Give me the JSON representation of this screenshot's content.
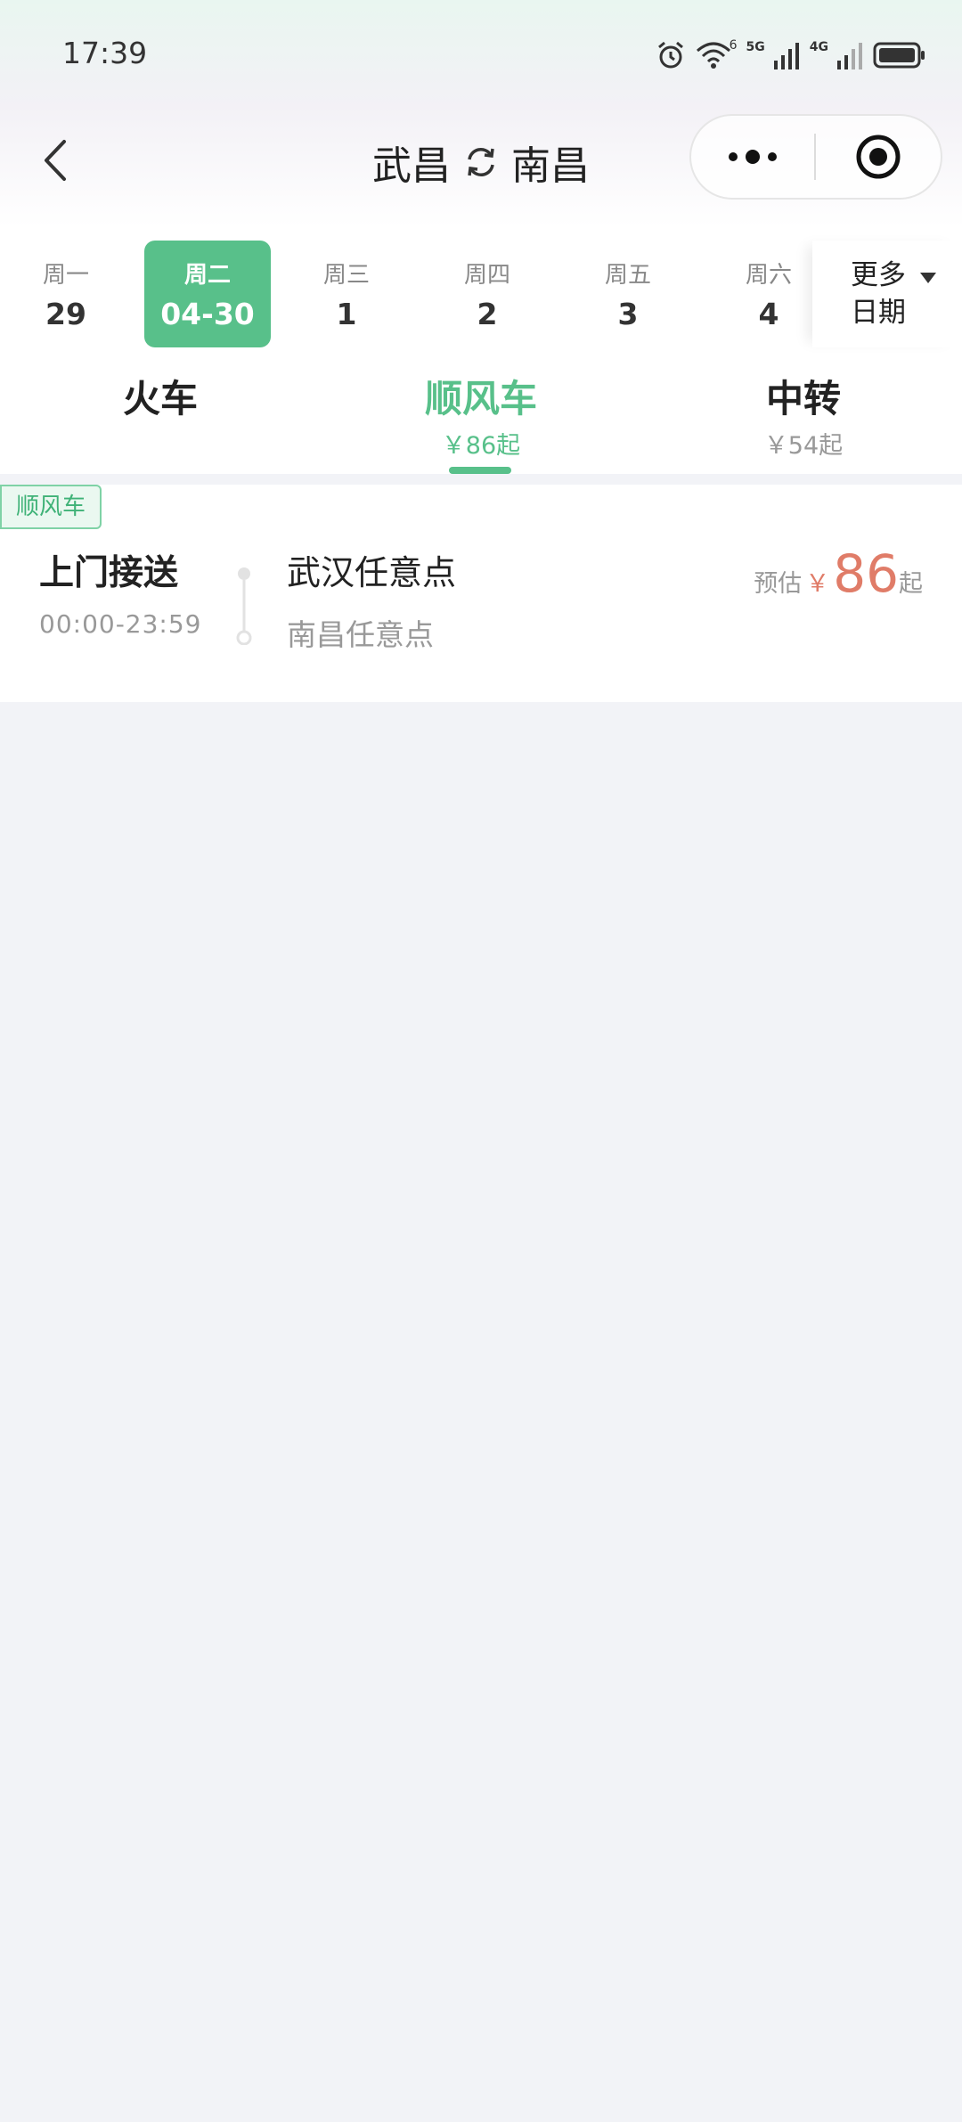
{
  "status": {
    "time": "17:39",
    "net1": "5G",
    "net2": "4G",
    "sim": "6"
  },
  "route": {
    "from": "武昌",
    "to": "南昌"
  },
  "dates": [
    {
      "weekday": "周一",
      "date": "29"
    },
    {
      "weekday": "周二",
      "date": "04-30",
      "active": true
    },
    {
      "weekday": "周三",
      "date": "1"
    },
    {
      "weekday": "周四",
      "date": "2"
    },
    {
      "weekday": "周五",
      "date": "3"
    },
    {
      "weekday": "周六",
      "date": "4"
    }
  ],
  "more_dates": {
    "line1": "更多",
    "line2": "日期"
  },
  "tabs": [
    {
      "name": "火车",
      "price": ""
    },
    {
      "name": "顺风车",
      "price": "￥86起",
      "active": true
    },
    {
      "name": "中转",
      "price": "￥54起"
    }
  ],
  "listing": {
    "tag": "顺风车",
    "service": "上门接送",
    "hours": "00:00-23:59",
    "from": "武汉任意点",
    "to": "南昌任意点",
    "estimate_label": "预估",
    "currency": "￥",
    "price": "86",
    "suffix": "起"
  },
  "colors": {
    "accent": "#58c08a",
    "price": "#e07c68"
  }
}
